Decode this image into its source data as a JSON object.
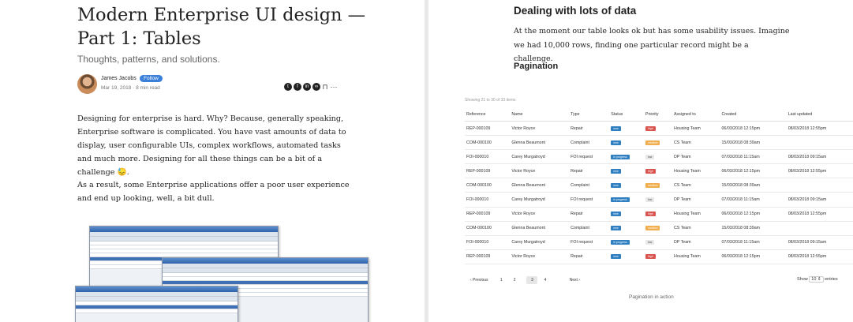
{
  "article": {
    "title": "Modern Enterprise UI design — Part 1: Tables",
    "subtitle": "Thoughts, patterns, and solutions.",
    "author": "James Jacobs",
    "follow_label": "Follow",
    "meta": "Mar 19, 2018 · 8 min read",
    "share_icons": [
      "twitter-icon",
      "facebook-icon",
      "linkedin-icon",
      "link-icon",
      "bookmark-icon",
      "more-icon"
    ],
    "paragraph1": "Designing for enterprise is hard. Why? Because, generally speaking, Enterprise software is complicated. You have vast amounts of data to display, user configurable UIs, complex workflows, automated tasks and much more. Designing for all these things can be a bit of a challenge 😓.",
    "paragraph2": "As a result, some Enterprise applications offer a poor user experience and end up looking, well, a bit dull."
  },
  "right": {
    "heading": "Dealing with lots of data",
    "text": "At the moment our table looks ok but has some usability issues. Imagine we had 10,000 rows, finding one particular record might be a challenge.",
    "subheading": "Pagination",
    "showing": "Showing 21 to 30 of 33 items",
    "columns": [
      "Reference",
      "Name",
      "Type",
      "Status",
      "Priority",
      "Assigned to",
      "Created",
      "Last updated"
    ],
    "rows": [
      {
        "ref": "REP-000109",
        "name": "Victor Royce",
        "type": "Repair",
        "status": "new",
        "priority": "high",
        "assigned": "Housing Team",
        "created": "06/03/2018 12:15pm",
        "updated": "08/03/2018 12:55pm"
      },
      {
        "ref": "COM-000100",
        "name": "Glenna Beaumont",
        "type": "Complaint",
        "status": "new",
        "priority": "medium",
        "assigned": "CS Team",
        "created": "15/03/2018 08:39am",
        "updated": ""
      },
      {
        "ref": "FOI-000010",
        "name": "Carey Murgatroyd",
        "type": "FOI request",
        "status": "in progress",
        "priority": "low",
        "assigned": "DP Team",
        "created": "07/03/2018 11:15am",
        "updated": "08/03/2018 09:15am"
      },
      {
        "ref": "REP-000109",
        "name": "Victor Royce",
        "type": "Repair",
        "status": "new",
        "priority": "high",
        "assigned": "Housing Team",
        "created": "06/03/2018 12:15pm",
        "updated": "08/03/2018 12:55pm"
      },
      {
        "ref": "COM-000100",
        "name": "Glenna Beaumont",
        "type": "Complaint",
        "status": "new",
        "priority": "medium",
        "assigned": "CS Team",
        "created": "15/03/2018 08:39am",
        "updated": ""
      },
      {
        "ref": "FOI-000010",
        "name": "Carey Murgatroyd",
        "type": "FOI request",
        "status": "in progress",
        "priority": "low",
        "assigned": "DP Team",
        "created": "07/03/2018 11:15am",
        "updated": "08/03/2018 09:15am"
      },
      {
        "ref": "REP-000109",
        "name": "Victor Royce",
        "type": "Repair",
        "status": "new",
        "priority": "high",
        "assigned": "Housing Team",
        "created": "06/03/2018 12:15pm",
        "updated": "08/03/2018 12:55pm"
      },
      {
        "ref": "COM-000100",
        "name": "Glenna Beaumont",
        "type": "Complaint",
        "status": "new",
        "priority": "medium",
        "assigned": "CS Team",
        "created": "15/03/2018 08:39am",
        "updated": ""
      },
      {
        "ref": "FOI-000010",
        "name": "Carey Murgatroyd",
        "type": "FOI request",
        "status": "in progress",
        "priority": "low",
        "assigned": "DP Team",
        "created": "07/03/2018 11:15am",
        "updated": "08/03/2018 09:15am"
      },
      {
        "ref": "REP-000109",
        "name": "Victor Royce",
        "type": "Repair",
        "status": "new",
        "priority": "high",
        "assigned": "Housing Team",
        "created": "06/03/2018 12:15pm",
        "updated": "08/03/2018 12:55pm"
      }
    ],
    "status_colors": {
      "new": "#2f7fc1",
      "in progress": "#2f7fc1"
    },
    "priority_colors": {
      "high": "#d9534f",
      "medium": "#f0ad4e",
      "low": "#e8e8e8"
    },
    "pagination": {
      "prev": "‹ Previous",
      "pages": [
        "1",
        "2",
        "3",
        "4"
      ],
      "current": "3",
      "next": "Next ›"
    },
    "show_label": "Show",
    "show_value": "10",
    "entries_label": "entries",
    "caption": "Pagination in action"
  }
}
